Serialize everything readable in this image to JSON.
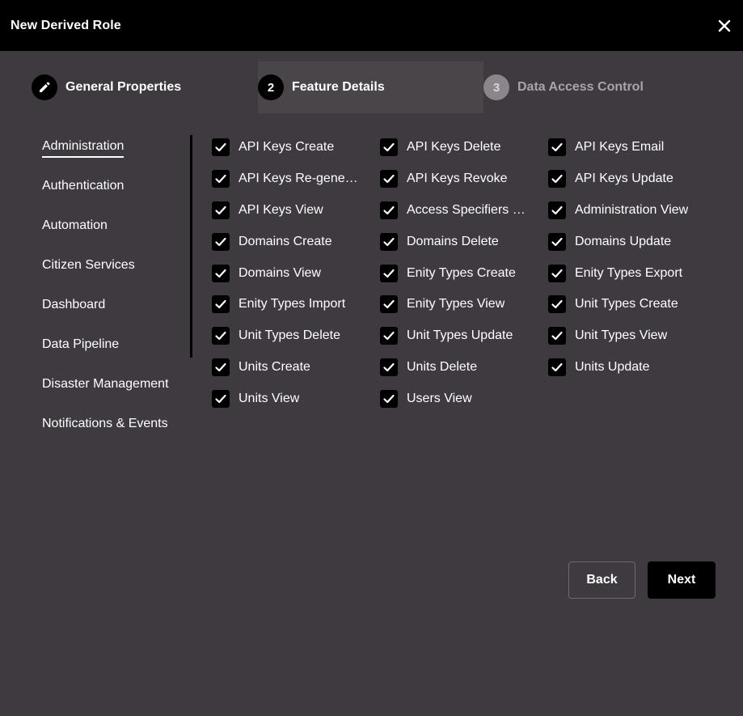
{
  "header": {
    "title": "New Derived Role"
  },
  "stepper": {
    "steps": [
      {
        "number": "",
        "label": "General Properties"
      },
      {
        "number": "2",
        "label": "Feature Details"
      },
      {
        "number": "3",
        "label": "Data Access Control"
      }
    ]
  },
  "sidebar": {
    "items": [
      {
        "label": "Administration"
      },
      {
        "label": "Authentication"
      },
      {
        "label": "Automation"
      },
      {
        "label": "Citizen Services"
      },
      {
        "label": "Dashboard"
      },
      {
        "label": "Data Pipeline"
      },
      {
        "label": "Disaster Management"
      },
      {
        "label": "Notifications & Events"
      }
    ]
  },
  "features": {
    "items": [
      {
        "label": "API Keys Create",
        "checked": true
      },
      {
        "label": "API Keys Delete",
        "checked": true
      },
      {
        "label": "API Keys Email",
        "checked": true
      },
      {
        "label": "API Keys Re-generate",
        "checked": true
      },
      {
        "label": "API Keys Revoke",
        "checked": true
      },
      {
        "label": "API Keys Update",
        "checked": true
      },
      {
        "label": "API Keys View",
        "checked": true
      },
      {
        "label": "Access Specifiers View",
        "checked": true
      },
      {
        "label": "Administration View",
        "checked": true
      },
      {
        "label": "Domains Create",
        "checked": true
      },
      {
        "label": "Domains Delete",
        "checked": true
      },
      {
        "label": "Domains Update",
        "checked": true
      },
      {
        "label": "Domains View",
        "checked": true
      },
      {
        "label": "Enity Types Create",
        "checked": true
      },
      {
        "label": "Enity Types Export",
        "checked": true
      },
      {
        "label": "Enity Types Import",
        "checked": true
      },
      {
        "label": "Enity Types View",
        "checked": true
      },
      {
        "label": "Unit Types Create",
        "checked": true
      },
      {
        "label": "Unit Types Delete",
        "checked": true
      },
      {
        "label": "Unit Types Update",
        "checked": true
      },
      {
        "label": "Unit Types View",
        "checked": true
      },
      {
        "label": "Units Create",
        "checked": true
      },
      {
        "label": "Units Delete",
        "checked": true
      },
      {
        "label": "Units Update",
        "checked": true
      },
      {
        "label": "Units View",
        "checked": true
      },
      {
        "label": "Users View",
        "checked": true
      }
    ]
  },
  "actions": {
    "back_label": "Back",
    "next_label": "Next"
  }
}
